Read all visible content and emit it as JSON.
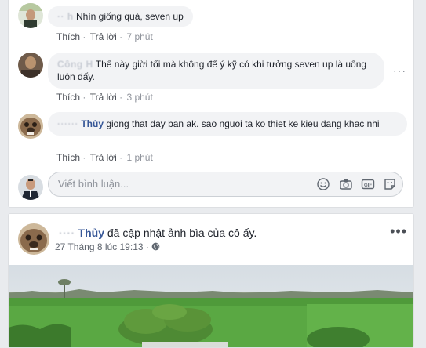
{
  "comments": [
    {
      "author_blurred": "·· h",
      "author": "",
      "text": "Nhìn giống quá, seven up",
      "actions": {
        "like": "Thích",
        "reply": "Trả lời",
        "time": "7 phút"
      }
    },
    {
      "author_blurred": "Công H",
      "author": "",
      "text": "Thế này giời tối mà không để ý kỹ có khi tưởng seven up là uống luôn đấy.",
      "actions": {
        "like": "Thích",
        "reply": "Trả lời",
        "time": "3 phút"
      }
    },
    {
      "author_blurred": "······",
      "author": "Thủy",
      "text": "giong that day ban ak. sao nguoi ta ko thiet ke kieu dang khac nhi",
      "actions": {
        "like": "Thích",
        "reply": "Trả lời",
        "time": "1 phút"
      }
    }
  ],
  "composer": {
    "placeholder": "Viết bình luận...",
    "icons": [
      "emoji-icon",
      "camera-icon",
      "gif-icon",
      "sticker-icon"
    ]
  },
  "post": {
    "author": "Thủy",
    "action_text": "đã cập nhật ảnh bìa của cô ấy.",
    "timestamp": "27 Tháng 8 lúc 19:13",
    "privacy_icon": "globe-icon"
  },
  "colors": {
    "link": "#385898",
    "bubble": "#f2f3f5",
    "page_bg": "#e9ebee"
  }
}
